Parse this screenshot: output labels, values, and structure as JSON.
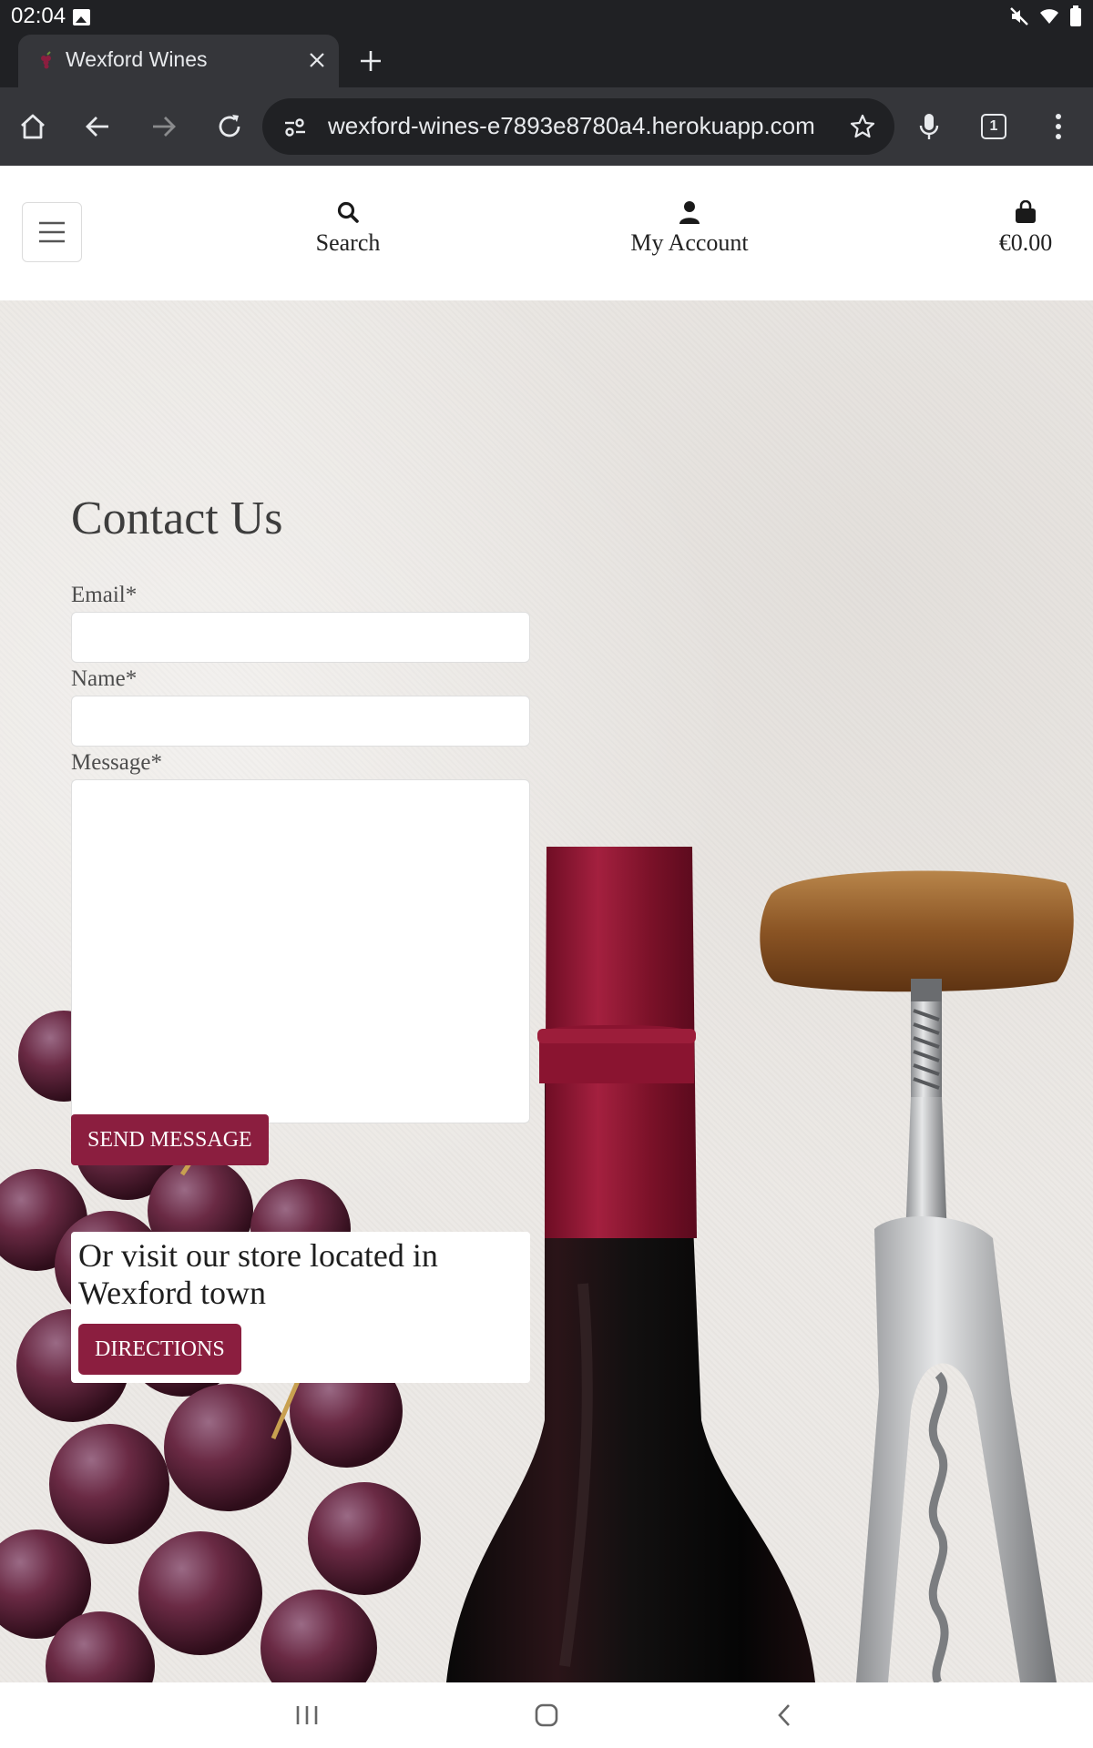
{
  "status_bar": {
    "time": "02:04"
  },
  "browser": {
    "tab_title": "Wexford Wines",
    "url": "wexford-wines-e7893e8780a4.herokuapp.com",
    "tab_count": "1"
  },
  "header": {
    "search_label": "Search",
    "account_label": "My Account",
    "cart_total": "€0.00"
  },
  "contact": {
    "title": "Contact Us",
    "email_label": "Email*",
    "email_value": "",
    "name_label": "Name*",
    "name_value": "",
    "message_label": "Message*",
    "message_value": "",
    "send_label": "SEND MESSAGE"
  },
  "visit": {
    "text": "Or visit our store located in Wexford town",
    "directions_label": "DIRECTIONS"
  },
  "colors": {
    "brand": "#8b1e3f",
    "browser_dark": "#202124"
  }
}
